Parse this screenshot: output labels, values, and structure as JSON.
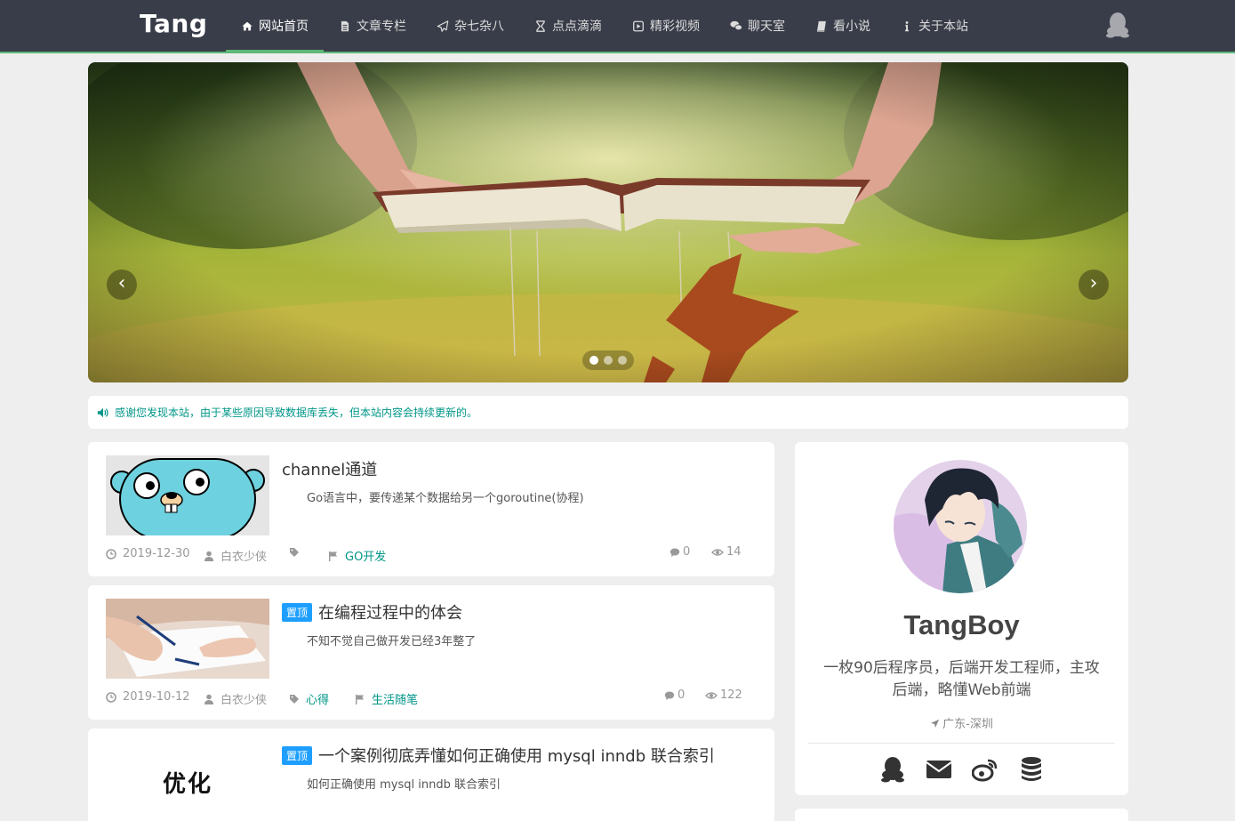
{
  "header": {
    "logo": "Tang",
    "nav": [
      {
        "label": "网站首页",
        "icon": "home-icon",
        "active": true
      },
      {
        "label": "文章专栏",
        "icon": "document-icon"
      },
      {
        "label": "杂七杂八",
        "icon": "paper-plane-icon"
      },
      {
        "label": "点点滴滴",
        "icon": "hourglass-icon"
      },
      {
        "label": "精彩视频",
        "icon": "play-square-icon"
      },
      {
        "label": "聊天室",
        "icon": "chat-bubbles-icon"
      },
      {
        "label": "看小说",
        "icon": "book-icon"
      },
      {
        "label": "关于本站",
        "icon": "info-icon"
      }
    ],
    "login_icon": "qq-icon"
  },
  "banner": {
    "prev": "‹",
    "next": "›",
    "slides": 3,
    "active_slide": 1
  },
  "notice": {
    "text": "感谢您发现本站，由于某些原因导致数据库丢失，但本站内容会持续更新的。"
  },
  "articles": [
    {
      "title": "channel通道",
      "pinned": false,
      "desc": "Go语言中，要传递某个数据给另一个goroutine(协程)",
      "date": "2019-12-30",
      "author": "白衣少侠",
      "tag": "",
      "category": "GO开发",
      "comments": "0",
      "views": "14"
    },
    {
      "title": "在编程过程中的体会",
      "pinned": true,
      "pin_label": "置顶",
      "desc": "不知不觉自己做开发已经3年整了",
      "date": "2019-10-12",
      "author": "白衣少侠",
      "tag": "心得",
      "category": "生活随笔",
      "comments": "0",
      "views": "122"
    },
    {
      "title": "一个案例彻底弄懂如何正确使用 mysql inndb 联合索引",
      "pinned": true,
      "pin_label": "置顶",
      "thumb_text": "优化",
      "desc": "如何正确使用 mysql inndb 联合索引"
    }
  ],
  "profile": {
    "name": "TangBoy",
    "bio": "一枚90后程序员，后端开发工程师，主攻后端，略懂Web前端",
    "location": "广东-深圳",
    "social": [
      "qq-icon",
      "mail-icon",
      "weibo-icon",
      "database-icon"
    ]
  },
  "colors": {
    "header_bg": "#393d49",
    "accent_green": "#5fb878",
    "link_teal": "#009688",
    "badge_blue": "#1e9fff",
    "page_bg": "#eeeeee"
  }
}
